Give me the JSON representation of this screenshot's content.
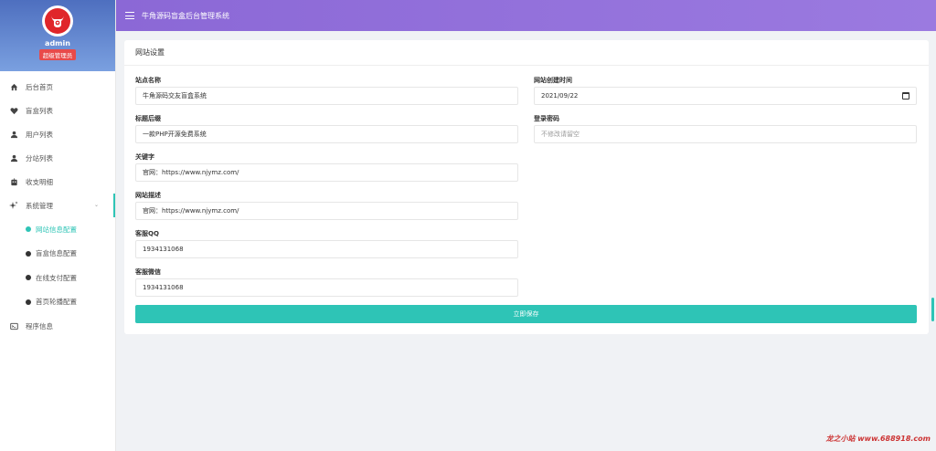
{
  "header": {
    "title": "牛角源码盲盒后台管理系统"
  },
  "profile": {
    "username": "admin",
    "role": "超级管理员"
  },
  "sidebar": {
    "items": [
      {
        "label": "后台首页",
        "icon": "home-icon"
      },
      {
        "label": "盲盒列表",
        "icon": "heart-icon"
      },
      {
        "label": "用户列表",
        "icon": "user-icon"
      },
      {
        "label": "分站列表",
        "icon": "user-icon"
      },
      {
        "label": "收支明细",
        "icon": "robot-icon"
      },
      {
        "label": "系统管理",
        "icon": "sparkle-icon"
      }
    ],
    "submenu": [
      {
        "label": "网站信息配置",
        "active": true
      },
      {
        "label": "盲盒信息配置",
        "active": false
      },
      {
        "label": "在线支付配置",
        "active": false
      },
      {
        "label": "首页轮播配置",
        "active": false
      }
    ],
    "last_item": {
      "label": "程序信息",
      "icon": "terminal-icon"
    }
  },
  "card": {
    "title": "网站设置"
  },
  "form": {
    "site_name": {
      "label": "站点名称",
      "value": "牛角源码交友盲盒系统"
    },
    "subtitle": {
      "label": "标题后缀",
      "value": "一款PHP开源免费系统"
    },
    "keywords": {
      "label": "关键字",
      "value": "官网：https://www.njymz.com/"
    },
    "description": {
      "label": "网站描述",
      "value": "官网：https://www.njymz.com/"
    },
    "qq": {
      "label": "客服QQ",
      "value": "1934131068"
    },
    "wechat": {
      "label": "客服微信",
      "value": "1934131068"
    },
    "created": {
      "label": "网站创建时间",
      "value": "2021/09/22"
    },
    "password": {
      "label": "登录密码",
      "placeholder": "不修改请留空"
    }
  },
  "actions": {
    "save_label": "立即保存"
  },
  "watermark": {
    "text": "龙之小站 www.688918.com"
  },
  "colors": {
    "accent": "#2ec4b6",
    "topbar": "#8b68d6",
    "badge": "#e84a4a"
  }
}
